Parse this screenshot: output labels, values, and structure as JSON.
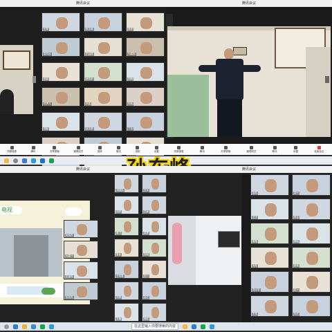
{
  "window_title": "腾讯会议",
  "banner_name": "孙东峰",
  "panel_top_left": {
    "tiles": [
      {
        "name": "王琴"
      },
      {
        "name": "陈志娟"
      },
      {
        "name": "张学"
      },
      {
        "name": "蔺鸿远"
      },
      {
        "name": "王启祥"
      },
      {
        "name": "刘建国"
      },
      {
        "name": "田羽"
      },
      {
        "name": "杨浩宇"
      },
      {
        "name": "刘翔"
      },
      {
        "name": "任梦凡"
      },
      {
        "name": "孙茉"
      },
      {
        "name": "刘伟"
      },
      {
        "name": "刘宏"
      },
      {
        "name": "赵文丽"
      },
      {
        "name": "丁洁"
      },
      {
        "name": "yuXiaobin"
      },
      {
        "name": "李珍义"
      },
      {
        "name": "王建珍"
      },
      {
        "name": "刘静"
      },
      {
        "name": "张亮"
      },
      {
        "name": "杨翊博"
      }
    ]
  },
  "panel_bottom_left": {
    "slide_title": "电视",
    "tiles": [
      {
        "name": "张俊杰"
      },
      {
        "name": "大星一"
      },
      {
        "name": "王者丹"
      },
      {
        "name": "张俊杰"
      }
    ]
  },
  "panel_bottom_mid": {
    "tiles": [
      {
        "name": "刘国庆"
      },
      {
        "name": "五字"
      },
      {
        "name": "刘学"
      },
      {
        "name": "王家"
      },
      {
        "name": "晨飞"
      },
      {
        "name": "张梦"
      },
      {
        "name": "张长"
      },
      {
        "name": "刘明"
      },
      {
        "name": "王明君"
      },
      {
        "name": "王一"
      },
      {
        "name": "刘李"
      },
      {
        "name": "赵红"
      },
      {
        "name": "王珊"
      },
      {
        "name": "程红"
      }
    ]
  },
  "panel_bottom_right": {
    "tiles": [
      {
        "name": "赵芳"
      },
      {
        "name": "梁兴"
      },
      {
        "name": "王宁"
      },
      {
        "name": "张芸"
      },
      {
        "name": "张丽"
      },
      {
        "name": "李晓"
      },
      {
        "name": "刘东"
      },
      {
        "name": "张伟"
      },
      {
        "name": "刘小宇"
      },
      {
        "name": "王一"
      },
      {
        "name": "王东"
      },
      {
        "name": "刘文"
      }
    ]
  },
  "toolbar": {
    "items": [
      "同原操麦",
      "腾讯",
      "共享屏幕",
      "管理成员",
      "邀请",
      "聊天",
      "录制",
      "设置",
      "结束会议"
    ]
  },
  "taskbar": {
    "search_placeholder": "在这里输入你要搜索的内容"
  }
}
